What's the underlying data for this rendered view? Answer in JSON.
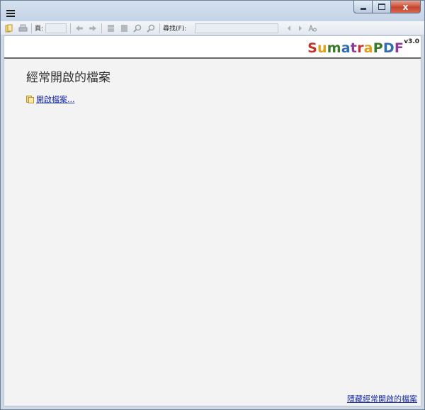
{
  "window": {
    "controls": {
      "minimize_label": "",
      "maximize_label": "",
      "close_label": "x"
    }
  },
  "toolbar": {
    "page_label": "頁:",
    "page_value": "",
    "find_label": "尋找(F):",
    "find_value": "",
    "icons": [
      "open-icon",
      "print-icon",
      "back-arrow-icon",
      "forward-arrow-icon",
      "single-page-icon",
      "continuous-page-icon",
      "zoom-in-icon",
      "zoom-out-icon",
      "find-prev-icon",
      "find-next-icon",
      "match-case-icon"
    ]
  },
  "brand": {
    "letters": [
      "S",
      "u",
      "m",
      "a",
      "t",
      "r",
      "a",
      "P",
      "D",
      "F"
    ],
    "version": "v3.0"
  },
  "home": {
    "title": "經常開啟的檔案",
    "open_file": "開啟檔案...",
    "hide_recent": "隱藏經常開啟的檔案"
  }
}
